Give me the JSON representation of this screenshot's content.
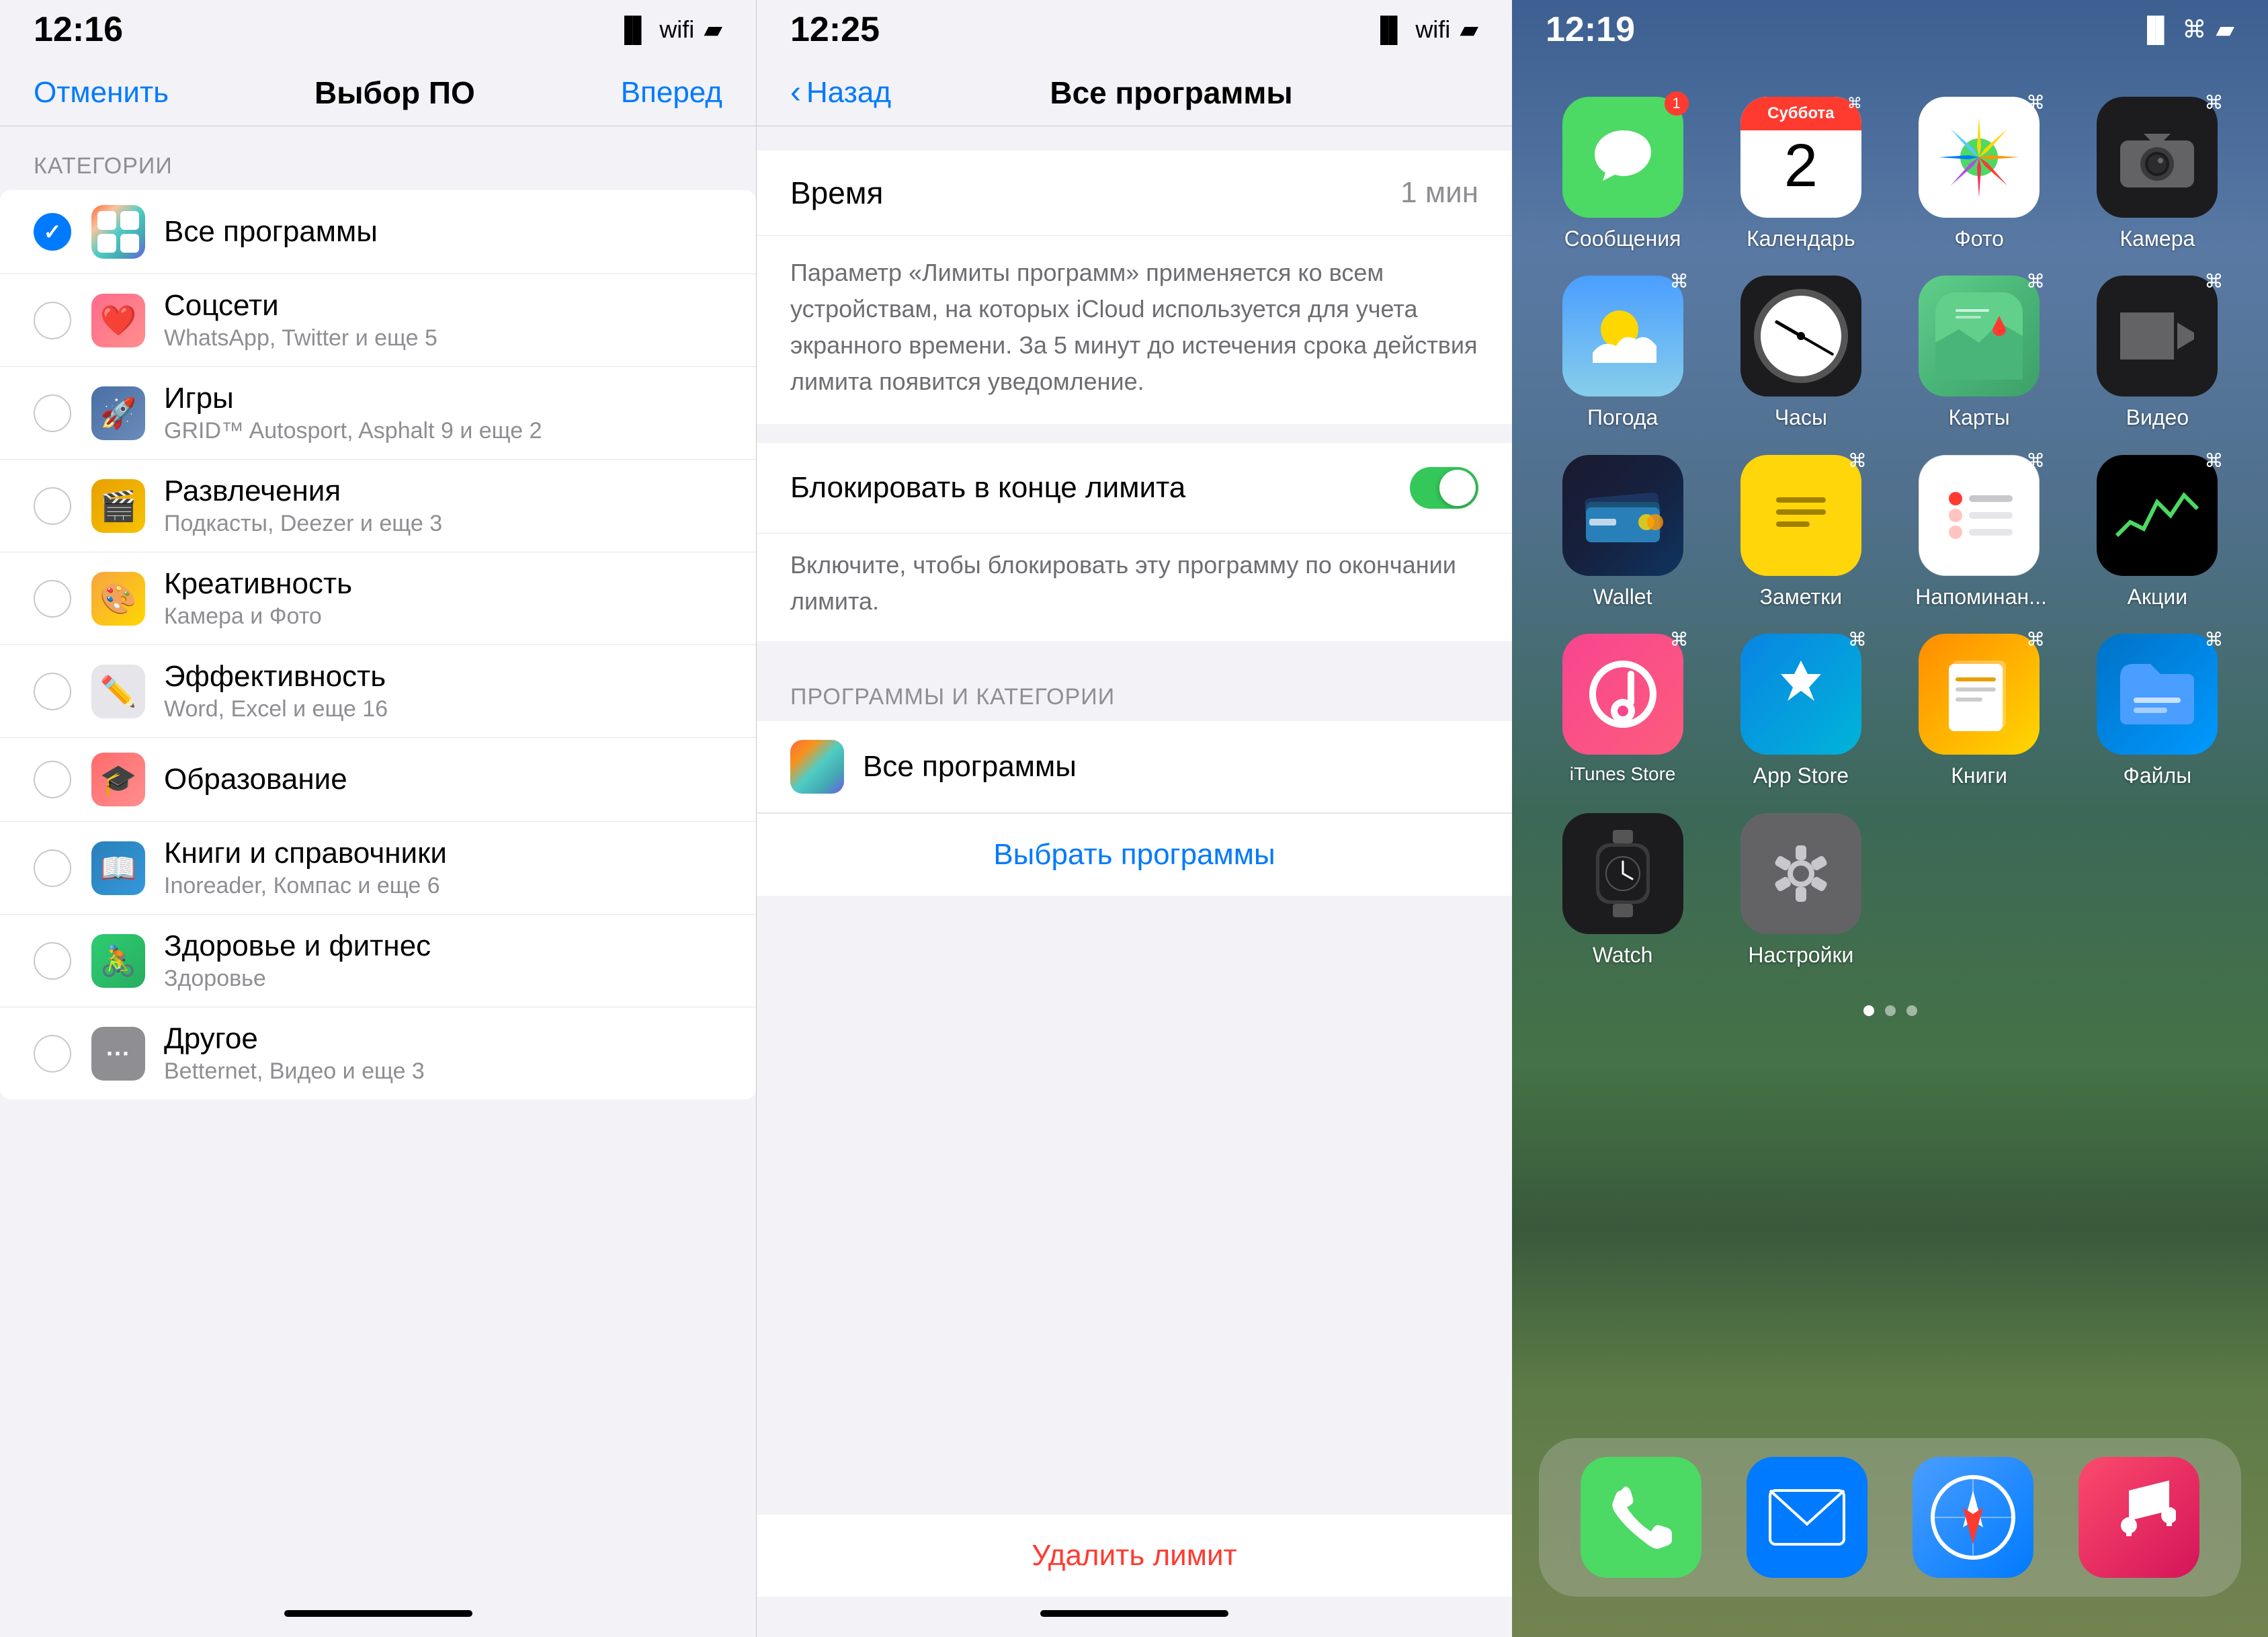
{
  "panel1": {
    "status": {
      "time": "12:16"
    },
    "nav": {
      "cancel": "Отменить",
      "title": "Выбор ПО",
      "forward": "Вперед"
    },
    "section_label": "КАТЕГОРИИ",
    "items": [
      {
        "id": "all",
        "label": "Все программы",
        "subtitle": "",
        "selected": true,
        "icon": "stack"
      },
      {
        "id": "social",
        "label": "Соцсети",
        "subtitle": "WhatsApp, Twitter и еще 5",
        "selected": false,
        "icon": "❤️"
      },
      {
        "id": "games",
        "label": "Игры",
        "subtitle": "GRID™ Autosport, Asphalt 9 и еще 2",
        "selected": false,
        "icon": "🚀"
      },
      {
        "id": "entertainment",
        "label": "Развлечения",
        "subtitle": "Подкасты, Deezer и еще 3",
        "selected": false,
        "icon": "🎬"
      },
      {
        "id": "creative",
        "label": "Креативность",
        "subtitle": "Камера и Фото",
        "selected": false,
        "icon": "🎨"
      },
      {
        "id": "productivity",
        "label": "Эффективность",
        "subtitle": "Word, Excel и еще 16",
        "selected": false,
        "icon": "✏️"
      },
      {
        "id": "education",
        "label": "Образование",
        "subtitle": "",
        "selected": false,
        "icon": "🎓"
      },
      {
        "id": "books",
        "label": "Книги и справочники",
        "subtitle": "Inoreader, Компас и еще 6",
        "selected": false,
        "icon": "📖"
      },
      {
        "id": "health",
        "label": "Здоровье и фитнес",
        "subtitle": "Здоровье",
        "selected": false,
        "icon": "🚴"
      },
      {
        "id": "other",
        "label": "Другое",
        "subtitle": "Betternet, Видео и еще 3",
        "selected": false,
        "icon": "···"
      }
    ]
  },
  "panel2": {
    "status": {
      "time": "12:25"
    },
    "nav": {
      "back": "Назад",
      "title": "Все программы"
    },
    "time_label": "Время",
    "time_value": "1 мин",
    "info_text": "Параметр «Лимиты программ» применяется ко всем устройствам, на которых iCloud используется для учета экранного времени. За 5 минут до истечения срока действия лимита появится уведомление.",
    "block_label": "Блокировать в конце лимита",
    "block_info": "Включите, чтобы блокировать эту программу по окончании лимита.",
    "programs_section": "ПРОГРАММЫ И КАТЕГОРИИ",
    "all_programs": "Все программы",
    "choose_btn": "Выбрать программы",
    "delete_btn": "Удалить лимит"
  },
  "panel3": {
    "status": {
      "time": "12:19"
    },
    "apps": [
      {
        "id": "messages",
        "label": "Сообщения",
        "icon": "messages"
      },
      {
        "id": "calendar",
        "label": "Календарь",
        "icon": "calendar",
        "day": "2",
        "dow": "Суббота"
      },
      {
        "id": "photos",
        "label": "Фото",
        "icon": "photos"
      },
      {
        "id": "camera",
        "label": "Камера",
        "icon": "camera"
      },
      {
        "id": "weather",
        "label": "Погода",
        "icon": "weather"
      },
      {
        "id": "clock",
        "label": "Часы",
        "icon": "clock"
      },
      {
        "id": "maps",
        "label": "Карты",
        "icon": "maps"
      },
      {
        "id": "video",
        "label": "Видео",
        "icon": "video"
      },
      {
        "id": "wallet",
        "label": "Wallet",
        "icon": "wallet"
      },
      {
        "id": "notes",
        "label": "Заметки",
        "icon": "notes"
      },
      {
        "id": "reminders",
        "label": "Напоминан...",
        "icon": "reminders"
      },
      {
        "id": "stocks",
        "label": "Акции",
        "icon": "stocks"
      },
      {
        "id": "itunes",
        "label": "iTunes Store",
        "icon": "itunes"
      },
      {
        "id": "appstore",
        "label": "App Store",
        "icon": "appstore"
      },
      {
        "id": "books",
        "label": "Книги",
        "icon": "books"
      },
      {
        "id": "files",
        "label": "Файлы",
        "icon": "files"
      },
      {
        "id": "watch",
        "label": "Watch",
        "icon": "watch"
      },
      {
        "id": "settings",
        "label": "Настройки",
        "icon": "settings"
      }
    ],
    "dock": [
      {
        "id": "phone",
        "label": "Телефон",
        "icon": "phone"
      },
      {
        "id": "mail",
        "label": "Mail",
        "icon": "mail"
      },
      {
        "id": "safari",
        "label": "Safari",
        "icon": "safari"
      },
      {
        "id": "music",
        "label": "Музыка",
        "icon": "music"
      }
    ],
    "locked_labels": [
      "Сообщения",
      "Календарь",
      "Фото",
      "Камера",
      "Погода",
      "Часы",
      "Карты",
      "Видео",
      "Wallet",
      "Заметки",
      "Напоминан...",
      "Акции",
      "iTunes Store",
      "App Store",
      "Книги",
      "Файлы",
      "Watch",
      "Настройки"
    ]
  }
}
